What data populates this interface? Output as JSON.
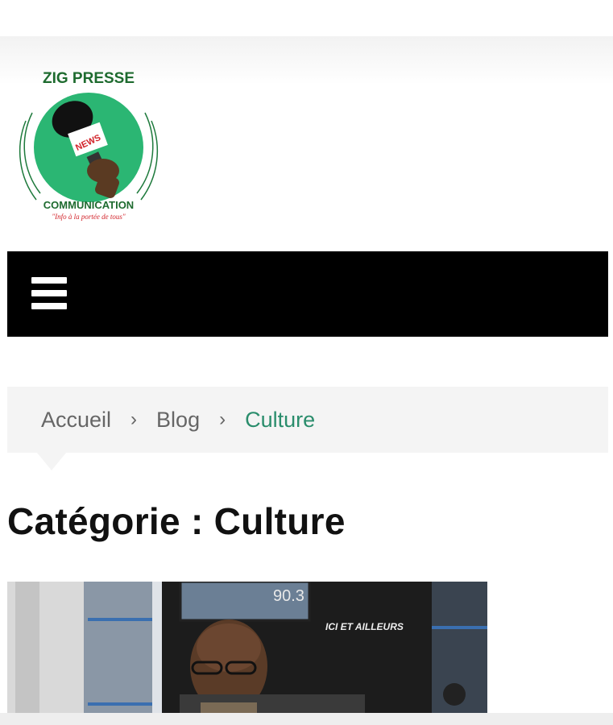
{
  "logo": {
    "top_text": "ZIG PRESSE",
    "mic_label": "NEWS",
    "bottom_text": "COMMUNICATION",
    "tagline": "\"Info à la portée de tous\""
  },
  "nav": {
    "menu_icon": "hamburger-menu-icon"
  },
  "breadcrumb": {
    "items": [
      "Accueil",
      "Blog"
    ],
    "current": "Culture",
    "separator": "›",
    "current_color": "#2a8d6c"
  },
  "page_title": "Catégorie : Culture",
  "featured_image": {
    "screen_text": "90.3",
    "wall_text": "ICI ET AILLEURS"
  },
  "colors": {
    "nav_background": "#000000",
    "breadcrumb_background": "#f4f4f4",
    "logo_green": "#2bb673",
    "logo_red": "#d2232a"
  }
}
